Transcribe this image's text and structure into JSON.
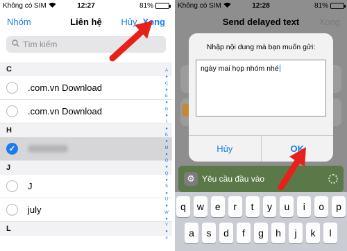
{
  "left": {
    "status": {
      "carrier": "Không có SIM",
      "time": "12:27",
      "battery": "81%",
      "battery_level": 0.81
    },
    "nav": {
      "back": "Nhóm",
      "title": "Liên hệ",
      "cancel": "Hủy",
      "done": "Xong"
    },
    "search": {
      "placeholder": "Tìm kiếm"
    },
    "sections": [
      {
        "letter": "C",
        "rows": [
          {
            "name": ".com.vn Download",
            "selected": false
          },
          {
            "name": ".com.vn Download",
            "selected": false
          }
        ]
      },
      {
        "letter": "H",
        "rows": [
          {
            "name": "",
            "selected": true,
            "blurred": true
          }
        ]
      },
      {
        "letter": "J",
        "rows": [
          {
            "name": "J",
            "selected": false
          },
          {
            "name": "july",
            "selected": false
          }
        ]
      },
      {
        "letter": "L",
        "rows": []
      }
    ],
    "index_letters": [
      "A",
      "●",
      "C",
      "●",
      "E",
      "●",
      "G",
      "●",
      "I",
      "●",
      "K",
      "●",
      "M",
      "●",
      "O",
      "●",
      "Q",
      "●",
      "S",
      "●",
      "U",
      "●",
      "W",
      "●",
      "Y",
      "●",
      "#"
    ]
  },
  "right": {
    "status": {
      "carrier": "Không có SIM",
      "time": "12:28",
      "battery": "81%",
      "battery_level": 0.81
    },
    "nav": {
      "title": "Send delayed text",
      "cancel": "Xong"
    },
    "dialog": {
      "title": "Nhập nội dung mà bạn muốn gửi:",
      "input_value": "ngày mai họp nhóm nhé",
      "cancel": "Hủy",
      "ok": "OK"
    },
    "action_bar": {
      "label": "Yêu cầu đầu vào"
    },
    "keyboard": {
      "rows": [
        [
          "q",
          "w",
          "e",
          "r",
          "t",
          "y",
          "u",
          "i",
          "o",
          "p"
        ],
        [
          "a",
          "s",
          "d",
          "f",
          "g",
          "h",
          "j",
          "k",
          "l"
        ]
      ]
    }
  },
  "colors": {
    "accent": "#1a7cf0",
    "arrow": "#e8201a",
    "action_bar": "#5b7848"
  },
  "icons": {
    "search": "search-icon",
    "wifi": "wifi-icon",
    "check": "checkmark-icon",
    "gear": "gear-icon",
    "arrow": "red-arrow-icon"
  }
}
